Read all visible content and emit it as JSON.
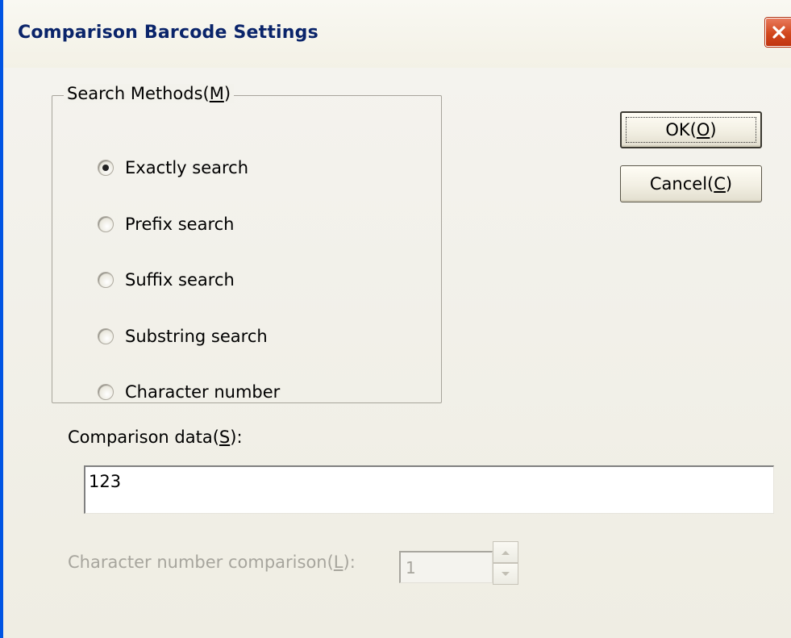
{
  "window": {
    "title": "Comparison Barcode Settings"
  },
  "search_methods": {
    "legend": "Search Methods(M)",
    "legend_prefix": "Search Methods(",
    "legend_mnemonic": "M",
    "legend_suffix": ")",
    "options": [
      {
        "label": "Exactly search",
        "checked": true
      },
      {
        "label": "Prefix search",
        "checked": false
      },
      {
        "label": "Suffix search",
        "checked": false
      },
      {
        "label": "Substring search",
        "checked": false
      },
      {
        "label": "Character number",
        "checked": false
      }
    ]
  },
  "buttons": {
    "ok_prefix": "OK(",
    "ok_mnemonic": "O",
    "ok_suffix": ")",
    "cancel_prefix": "Cancel(",
    "cancel_mnemonic": "C",
    "cancel_suffix": ")"
  },
  "comparison_data": {
    "label_prefix": "Comparison data(",
    "label_mnemonic": "S",
    "label_suffix": "):",
    "value": "123"
  },
  "char_number": {
    "label_prefix": "Character number comparison(",
    "label_mnemonic": "L",
    "label_suffix": "):",
    "value": "1",
    "enabled": false
  },
  "colors": {
    "title_text": "#0a246a",
    "close_button": "#d2471d",
    "disabled_text": "#a7a59d"
  },
  "icons": {
    "close": "close-icon",
    "spin_up": "spin-up-arrow-icon",
    "spin_down": "spin-down-arrow-icon"
  }
}
